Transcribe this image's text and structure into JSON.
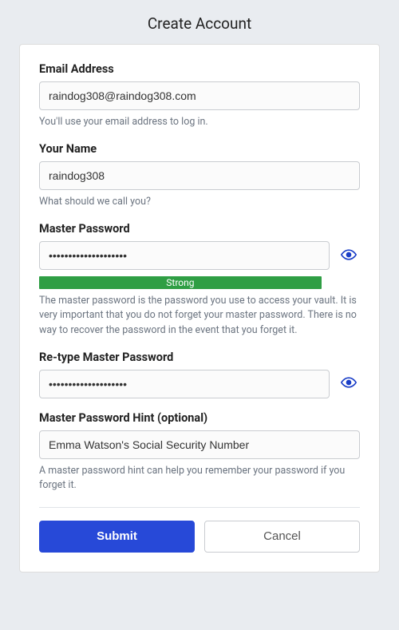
{
  "page": {
    "title": "Create Account"
  },
  "fields": {
    "email": {
      "label": "Email Address",
      "value": "raindog308@raindog308.com",
      "hint": "You'll use your email address to log in."
    },
    "name": {
      "label": "Your Name",
      "value": "raindog308",
      "hint": "What should we call you?"
    },
    "master_password": {
      "label": "Master Password",
      "value": "••••••••••••••••••••",
      "strength_label": "Strong",
      "strength_color": "#2f9e44",
      "hint": "The master password is the password you use to access your vault. It is very important that you do not forget your master password. There is no way to recover the password in the event that you forget it."
    },
    "retype_password": {
      "label": "Re-type Master Password",
      "value": "••••••••••••••••••••"
    },
    "hint_field": {
      "label": "Master Password Hint (optional)",
      "value": "Emma Watson's Social Security Number",
      "hint": "A master password hint can help you remember your password if you forget it."
    }
  },
  "buttons": {
    "submit": "Submit",
    "cancel": "Cancel"
  },
  "icons": {
    "eye_color": "#1a3ec7"
  }
}
